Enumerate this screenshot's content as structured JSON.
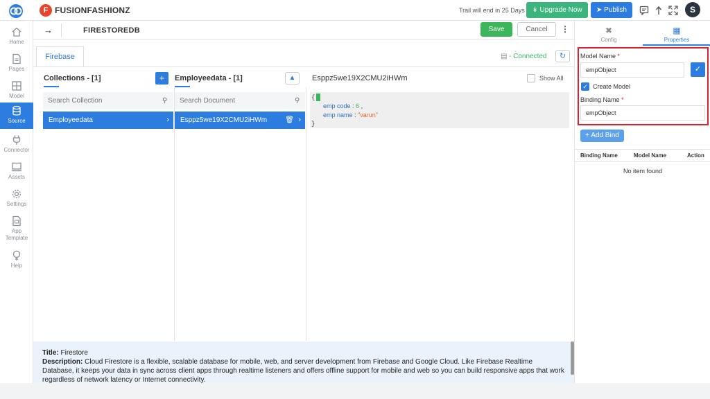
{
  "topbar": {
    "app_name": "FUSIONFASHIONZ",
    "app_logo_letter": "F",
    "trial_text": "Trail will end in 25 Days",
    "upgrade_label": "Upgrade Now",
    "publish_label": "Publish",
    "avatar_letter": "S"
  },
  "sidebar": {
    "items": [
      {
        "label": "Home",
        "icon": "home-icon"
      },
      {
        "label": "Pages",
        "icon": "pages-icon"
      },
      {
        "label": "Model",
        "icon": "model-icon"
      },
      {
        "label": "Source",
        "icon": "database-icon"
      },
      {
        "label": "Connector",
        "icon": "plug-icon"
      },
      {
        "label": "Assets",
        "icon": "monitor-icon"
      },
      {
        "label": "Settings",
        "icon": "gear-icon"
      },
      {
        "label": "App\nTemplate",
        "icon": "template-icon"
      },
      {
        "label": "Help",
        "icon": "help-icon"
      }
    ],
    "active": "Source"
  },
  "subbar": {
    "title": "FIRESTOREDB",
    "save_label": "Save",
    "cancel_label": "Cancel"
  },
  "main": {
    "tab": "Firebase",
    "status": "Connected",
    "collections": {
      "heading": "Collections - [1]",
      "search_placeholder": "Search Collection",
      "items": [
        "Employeedata"
      ]
    },
    "documents": {
      "heading": "Employeedata - [1]",
      "search_placeholder": "Search Document",
      "items": [
        "Esppz5we19X2CMU2iHWm"
      ]
    },
    "document_view": {
      "heading": "Esppz5we19X2CMU2iHWm",
      "show_all_label": "Show All",
      "json": {
        "open": "{",
        "close": "}",
        "fields": [
          {
            "key": "emp code",
            "sep": " : ",
            "value": "6",
            "suffix": " ,",
            "type": "number"
          },
          {
            "key": "emp name",
            "sep": " : ",
            "value": "\"varun\"",
            "suffix": "",
            "type": "string"
          }
        ]
      }
    }
  },
  "description": {
    "title_label": "Title:",
    "title_value": "Firestore",
    "desc_label": "Description:",
    "desc_value": "Cloud Firestore is a flexible, scalable database for mobile, web, and server development from Firebase and Google Cloud. Like Firebase Realtime Database, it keeps your data in sync across client apps through realtime listeners and offers offline support for mobile and web so you can build responsive apps that work regardless of network latency or Internet connectivity."
  },
  "right_panel": {
    "tabs": [
      "Config",
      "Properties"
    ],
    "active_tab": "Properties",
    "model_name_label": "Model Name",
    "model_name_value": "empObject",
    "create_model_label": "Create Model",
    "binding_name_label": "Binding Name",
    "binding_name_value": "empObject",
    "required_mark": "*",
    "add_bind_label": "Add Bind",
    "table_headers": [
      "Binding Name",
      "Model Name",
      "Action"
    ],
    "empty_text": "No item found"
  },
  "colors": {
    "accent": "#2d7de0",
    "success": "#3cb65a",
    "highlight_border": "#e0202e"
  }
}
